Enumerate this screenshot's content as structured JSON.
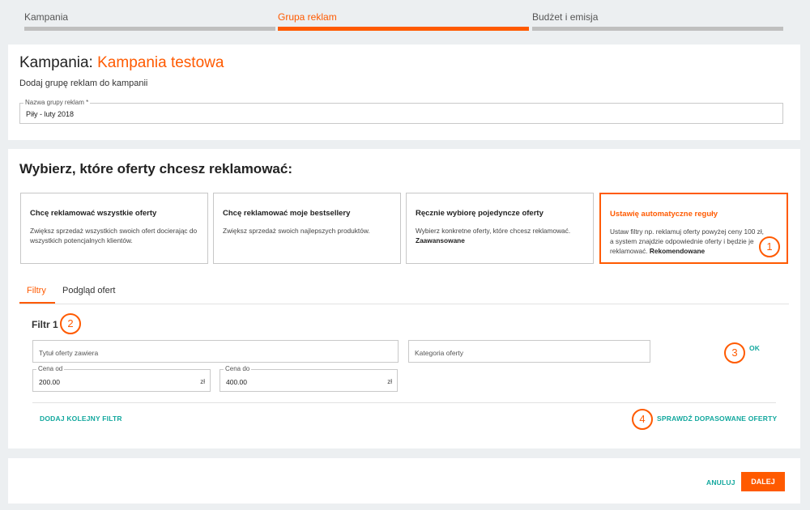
{
  "stepper": {
    "steps": [
      {
        "label": "Kampania"
      },
      {
        "label": "Grupa reklam"
      },
      {
        "label": "Budżet i emisja"
      }
    ]
  },
  "campaign": {
    "prefix": "Kampania: ",
    "name": "Kampania testowa",
    "subtitle": "Dodaj grupę reklam do kampanii",
    "group_name_label": "Nazwa grupy reklam *",
    "group_name_value": "Piły - luty 2018"
  },
  "offers": {
    "heading": "Wybierz, które oferty chcesz reklamować:",
    "cards": [
      {
        "title": "Chcę reklamować wszystkie oferty",
        "desc": "Zwiększ sprzedaż wszystkich swoich ofert docierając do wszystkich potencjalnych klientów.",
        "tag": ""
      },
      {
        "title": "Chcę reklamować moje bestsellery",
        "desc": "Zwiększ sprzedaż swoich najlepszych produktów.",
        "tag": ""
      },
      {
        "title": "Ręcznie wybiorę pojedyncze oferty",
        "desc": "Wybierz konkretne oferty, które chcesz reklamować.",
        "tag": "Zaawansowane"
      },
      {
        "title": "Ustawię automatyczne reguły",
        "desc": "Ustaw filtry np. reklamuj oferty powyżej ceny 100 zł, a system znajdzie odpowiednie oferty i będzie je reklamować.",
        "tag": "Rekomendowane"
      }
    ],
    "selected_index": 3
  },
  "tabs": [
    {
      "label": "Filtry"
    },
    {
      "label": "Podgląd ofert"
    }
  ],
  "filter": {
    "title": "Filtr 1",
    "title_placeholder": "Tytuł oferty zawiera",
    "category_placeholder": "Kategoria oferty",
    "price_from_label": "Cena od",
    "price_from_value": "200.00",
    "price_to_label": "Cena do",
    "price_to_value": "400.00",
    "currency": "zł",
    "ok_label": "OK",
    "add_filter_label": "DODAJ KOLEJNY FILTR",
    "check_offers_label": "SPRAWDŹ DOPASOWANE OFERTY"
  },
  "markers": [
    "1",
    "2",
    "3",
    "4"
  ],
  "footer": {
    "cancel_label": "ANULUJ",
    "next_label": "DALEJ"
  },
  "colors": {
    "accent": "#ff5a00",
    "link": "#13a89e",
    "background": "#eceff1"
  }
}
